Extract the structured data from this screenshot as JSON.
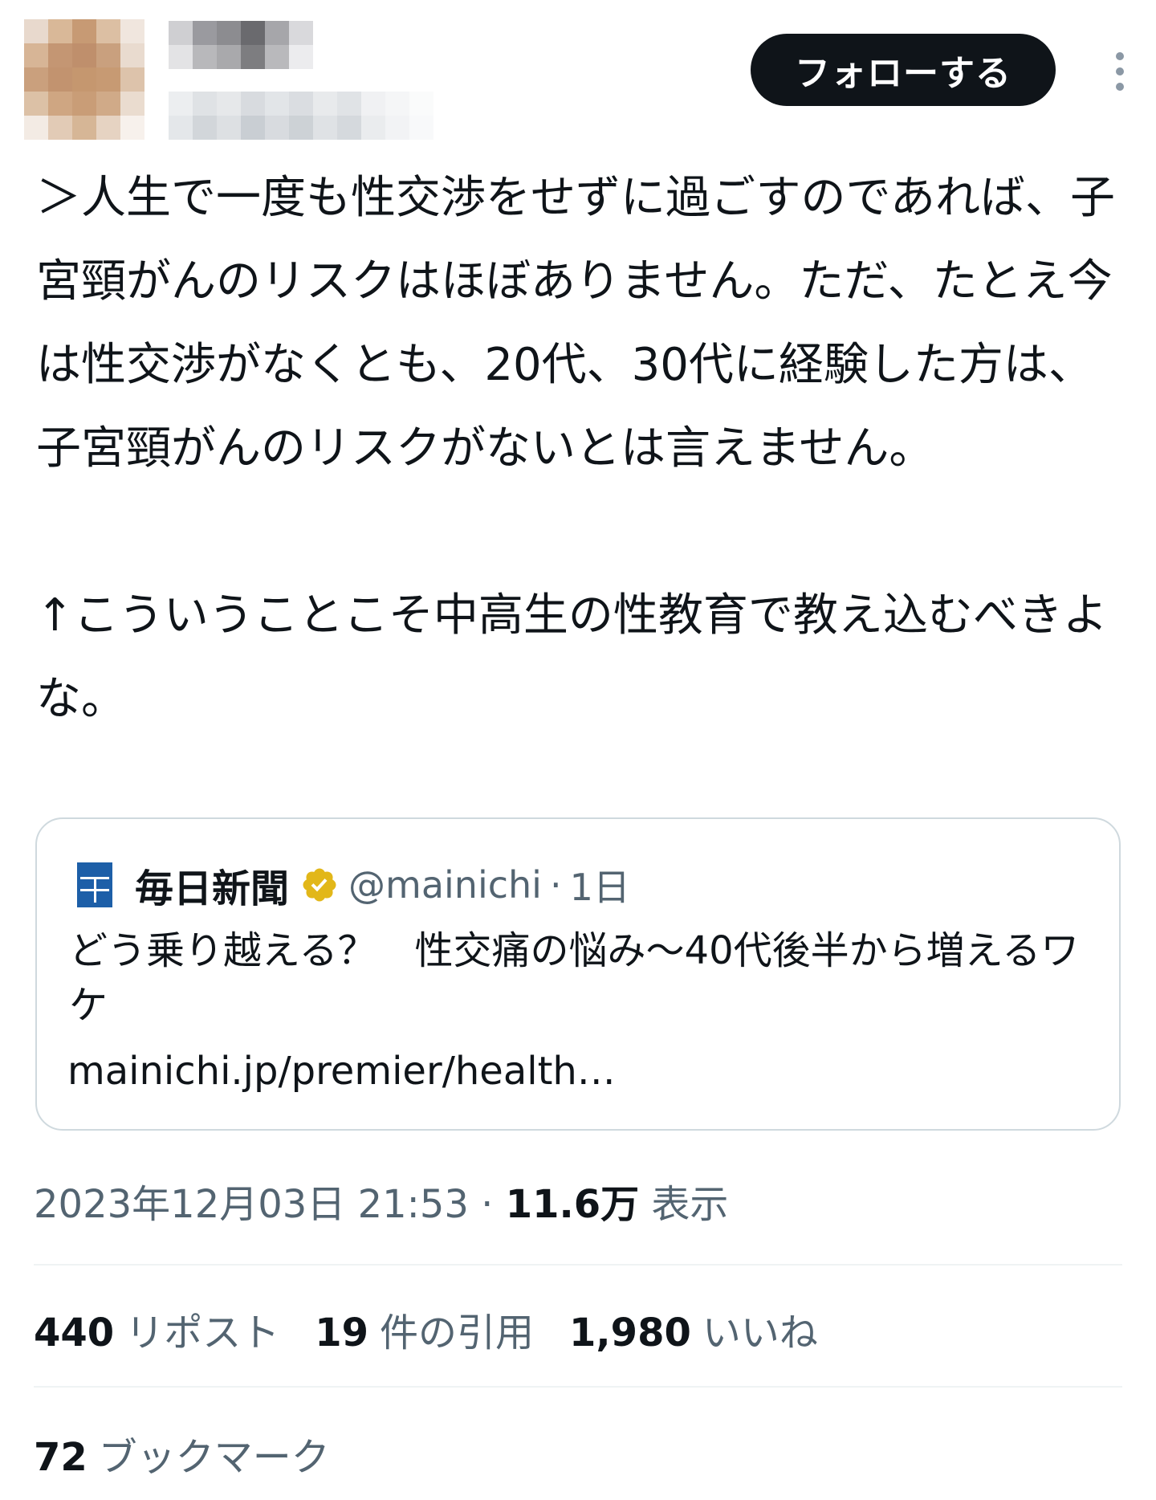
{
  "header": {
    "follow_label": "フォローする"
  },
  "tweet": {
    "text": "＞人生で一度も性交渉をせずに過ごすのであれば、子宮頸がんのリスクはほぼありません。ただ、たとえ今は性交渉がなくとも、20代、30代に経験した方は、子宮頸がんのリスクがないとは言えません。\n\n↑こういうことこそ中高生の性教育で教え込むべきよな。"
  },
  "quote": {
    "name": "毎日新聞",
    "handle": "@mainichi",
    "separator": "·",
    "time": "1日",
    "text": "どう乗り越える？　性交痛の悩み～40代後半から増えるワケ",
    "link": "mainichi.jp/premier/health…"
  },
  "meta": {
    "datetime": "2023年12月03日 21:53",
    "separator": "·",
    "views_count": "11.6万",
    "views_label": "表示"
  },
  "stats": {
    "reposts_count": "440",
    "reposts_label": "リポスト",
    "quotes_count": "19",
    "quotes_label": "件の引用",
    "likes_count": "1,980",
    "likes_label": "いいね",
    "bookmarks_count": "72",
    "bookmarks_label": "ブックマーク"
  },
  "colors": {
    "verified_badge": "#e2b719",
    "secondary_text": "#536471",
    "follow_button_bg": "#0f1419"
  },
  "icons": {
    "more": "more-vertical-icon",
    "verified": "verified-badge-icon",
    "logo": "mainichi-logo-icon"
  }
}
